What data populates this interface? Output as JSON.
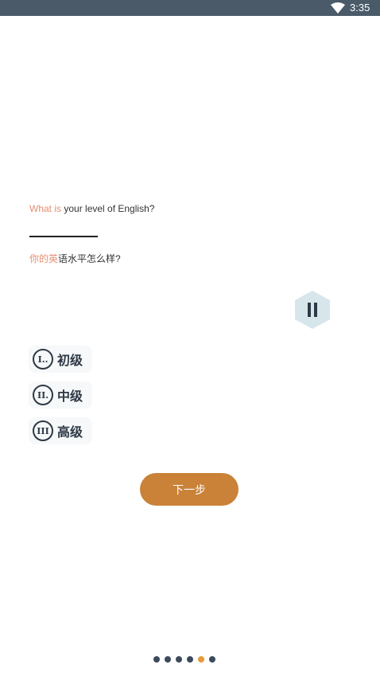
{
  "status_bar": {
    "time": "3:35",
    "wifi_icon": "wifi-icon"
  },
  "question": {
    "en_highlight": "What is",
    "en_rest": " your level of English?",
    "cn_highlight": "你的英",
    "cn_rest": "语水平怎么样?"
  },
  "pause_icon": "pause-icon",
  "options": [
    {
      "num": "I..",
      "label": "初级"
    },
    {
      "num": "II.",
      "label": "中级"
    },
    {
      "num": "III",
      "label": "高级"
    }
  ],
  "next_button": {
    "label": "下一步"
  },
  "pager": {
    "total": 6,
    "active_index": 4
  },
  "colors": {
    "accent": "#c98238",
    "highlight": "#e58e72",
    "status_bar": "#4a5a68",
    "dot_active": "#e59b3a",
    "dot_inactive": "#3c4a5a"
  }
}
